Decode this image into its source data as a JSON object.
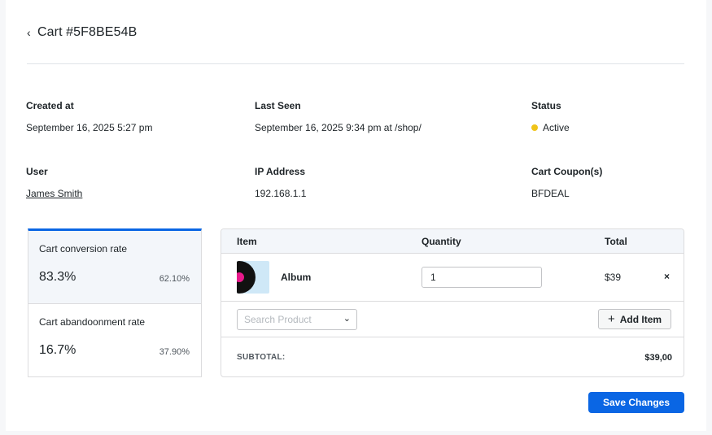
{
  "header": {
    "back_icon": "chevron-left-icon",
    "title": "Cart #5F8BE54B"
  },
  "meta": {
    "created_at": {
      "label": "Created at",
      "value": "September 16, 2025 5:27 pm"
    },
    "last_seen": {
      "label": "Last Seen",
      "value": "September 16, 2025 9:34 pm at /shop/"
    },
    "status": {
      "label": "Status",
      "value": "Active",
      "color": "#f0c419"
    },
    "user": {
      "label": "User",
      "value": "James Smith"
    },
    "ip": {
      "label": "IP Address",
      "value": "192.168.1.1"
    },
    "coupon": {
      "label": "Cart Coupon(s)",
      "value": "BFDEAL"
    }
  },
  "stats": [
    {
      "label": "Cart conversion rate",
      "value": "83.3%",
      "percent": "62.10%"
    },
    {
      "label": "Cart abandoonment rate",
      "value": "16.7%",
      "percent": "37.90%"
    }
  ],
  "table": {
    "headers": {
      "item": "Item",
      "quantity": "Quantity",
      "total": "Total"
    },
    "rows": [
      {
        "name": "Album",
        "quantity": "1",
        "total": "$39",
        "remove": "×",
        "thumb_icon": "vinyl-record-icon"
      }
    ],
    "search_placeholder": "Search Product",
    "add_item": "Add Item",
    "subtotal_label": "SUBTOTAL:",
    "subtotal_value": "$39,00"
  },
  "actions": {
    "save": "Save Changes"
  },
  "colors": {
    "accent": "#0a66e4",
    "status_active": "#f0c419"
  }
}
